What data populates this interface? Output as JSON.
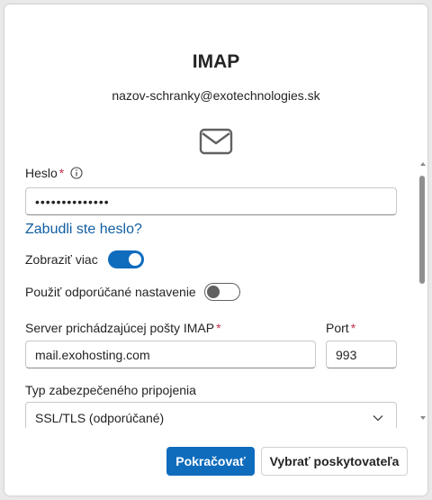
{
  "dialog": {
    "title": "IMAP",
    "email": "nazov-schranky@exotechnologies.sk"
  },
  "form": {
    "password_label": "Heslo",
    "required_mark": "*",
    "password_value": "••••••••••••••",
    "forgot_link": "Zabudli ste heslo?",
    "show_more_label": "Zobraziť viac",
    "show_more_on": true,
    "recommended_label": "Použiť odporúčané nastavenie",
    "recommended_on": false,
    "server_label": "Server prichádzajúcej pošty IMAP",
    "server_value": "mail.exohosting.com",
    "port_label": "Port",
    "port_value": "993",
    "security_label": "Typ zabezpečeného pripojenia",
    "security_value": "SSL/TLS (odporúčané)"
  },
  "buttons": {
    "continue": "Pokračovať",
    "choose_provider": "Vybrať poskytovateľa"
  },
  "colors": {
    "accent": "#0f6cbd",
    "link": "#115ea3",
    "required": "#c4314b"
  },
  "icons": {
    "mail": "envelope-icon",
    "info": "info-icon",
    "chevron": "chevron-down-icon"
  }
}
